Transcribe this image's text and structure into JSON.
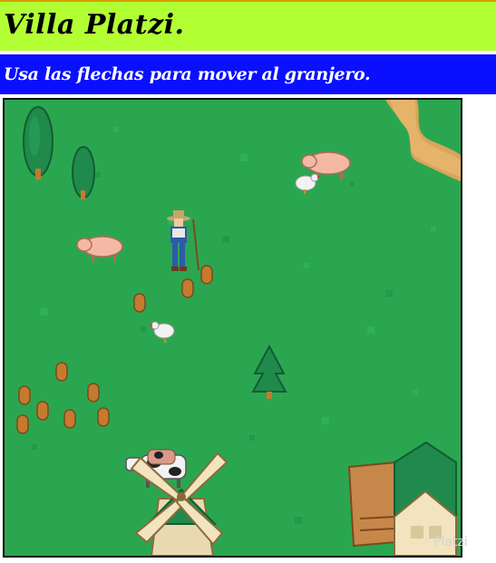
{
  "header": {
    "title": "Villa Platzi."
  },
  "instructions": {
    "text": "Usa las flechas para mover al granjero."
  },
  "game": {
    "colors": {
      "grass": "#2ba650",
      "path": "#d9a55a",
      "tree": "#1f8a4c",
      "stump": "#c57a2e"
    },
    "sprites": [
      "farmer",
      "pig",
      "pig",
      "chicken",
      "chicken",
      "cow",
      "cow",
      "windmill",
      "barn",
      "tree",
      "tree",
      "tree",
      "stump"
    ]
  },
  "watermark": {
    "text": "Platzi"
  }
}
